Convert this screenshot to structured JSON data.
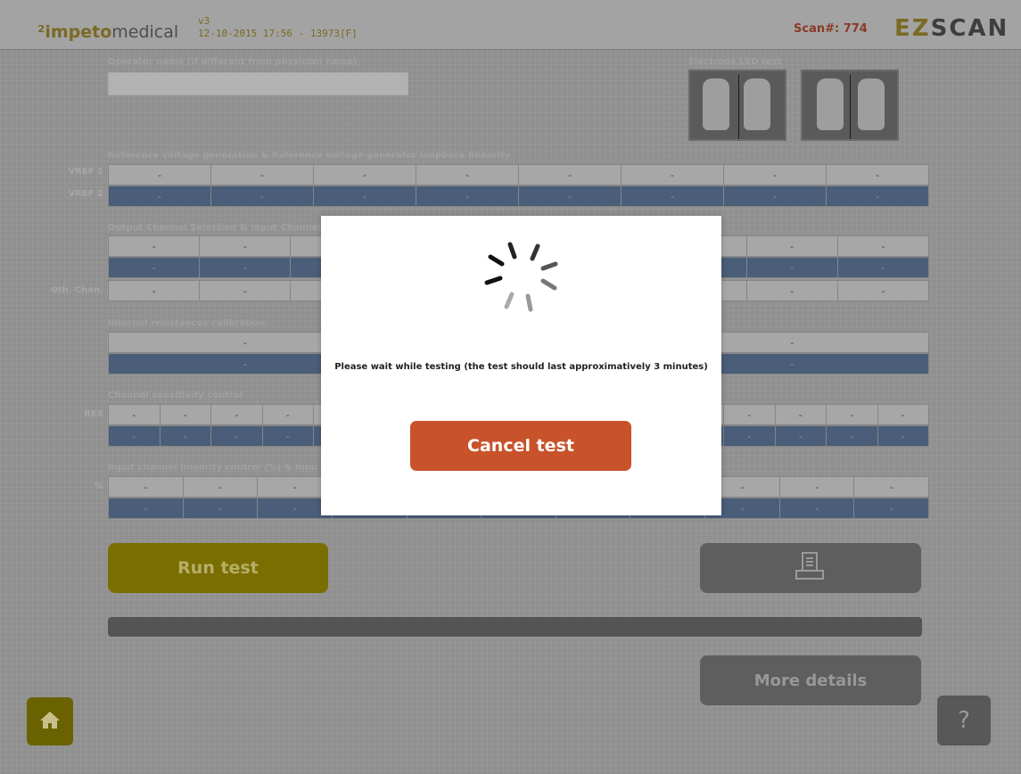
{
  "header": {
    "logo_prefix": "²impeto",
    "logo_suffix": "medical",
    "version": "v3",
    "datetime": "12-10-2015 17:56 - 13973[F]",
    "scan_label": "Scan#:",
    "scan_number": "774",
    "brand_ez": "EZ",
    "brand_scan": "SCAN"
  },
  "operator": {
    "label": "Operator name (if different from physician name)",
    "value": ""
  },
  "electrode": {
    "label": "Electrode LED test"
  },
  "vref": {
    "label": "Reference voltage generation & Reference voltage generator loopback linearity",
    "row1_label": "VREF 1",
    "row2_label": "VREF 2",
    "row1": [
      "-",
      "-",
      "-",
      "-",
      "-",
      "-",
      "-",
      "-"
    ],
    "row2": [
      "-",
      "-",
      "-",
      "-",
      "-",
      "-",
      "-",
      "-"
    ]
  },
  "output_channel": {
    "label": "Output Channel Selection & Input Channel",
    "oth_label": "0th. Chan.",
    "row1": [
      "-",
      "-",
      "-",
      "-",
      "-",
      "-",
      "-",
      "-",
      "-"
    ],
    "row2": [
      "-",
      "-",
      "-",
      "-",
      "-",
      "-",
      "-",
      "-",
      "-"
    ],
    "row3": [
      "-",
      "-",
      "-",
      "-",
      "-",
      "-",
      "-",
      "-",
      "-"
    ]
  },
  "internal_res": {
    "label": "Internal resistances calibration",
    "row1": [
      "-",
      "-",
      "-"
    ],
    "row2": [
      "-",
      "-",
      "-"
    ]
  },
  "sensitivity": {
    "label": "Channel sensitivity control",
    "res_label": "RES",
    "row1": [
      "-",
      "-",
      "-",
      "-",
      "-",
      "-",
      "-",
      "-",
      "-",
      "-",
      "-",
      "-",
      "-",
      "-",
      "-",
      "-"
    ],
    "row2": [
      "-",
      "-",
      "-",
      "-",
      "-",
      "-",
      "-",
      "-",
      "-",
      "-",
      "-",
      "-",
      "-",
      "-",
      "-",
      "-"
    ]
  },
  "linearity": {
    "label": "Input channel linearity control (%) & Inpu",
    "pct_label": "%",
    "row1": [
      "-",
      "-",
      "-",
      "-",
      "-",
      "-",
      "-",
      "-",
      "-",
      "-",
      "-"
    ],
    "row2": [
      "-",
      "-",
      "-",
      "-",
      "-",
      "-",
      "-",
      "-",
      "-",
      "-",
      "-"
    ]
  },
  "buttons": {
    "run_test": "Run test",
    "more_details": "More details",
    "help": "?"
  },
  "progress_value": 0,
  "modal": {
    "message": "Please wait while testing (the test should last approximatively 3 minutes)",
    "cancel_label": "Cancel test"
  },
  "icons": {
    "home": "home-icon",
    "print": "printer-icon",
    "spinner": "loading-spinner-icon"
  }
}
